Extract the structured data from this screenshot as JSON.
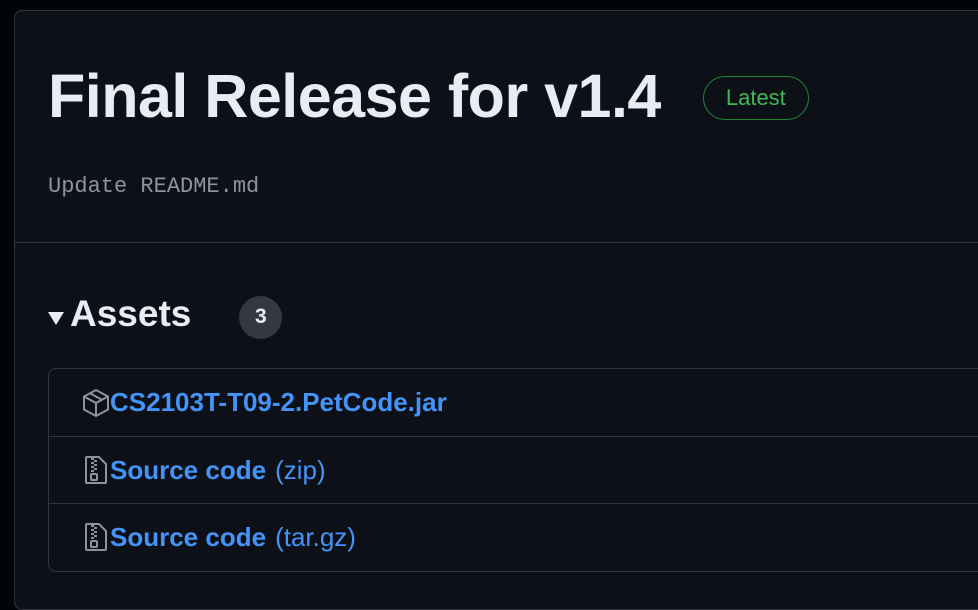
{
  "release": {
    "title": "Final Release for v1.4",
    "badge": "Latest",
    "commit_message": "Update README.md"
  },
  "assets": {
    "heading": "Assets",
    "count": "3",
    "items": [
      {
        "name": "CS2103T-T09-2.PetCode.jar",
        "suffix": "",
        "icon": "package-icon"
      },
      {
        "name": "Source code",
        "suffix": "(zip)",
        "icon": "file-zip-icon"
      },
      {
        "name": "Source code",
        "suffix": "(tar.gz)",
        "icon": "file-zip-icon"
      }
    ]
  },
  "colors": {
    "background": "#0d1117",
    "border": "#30363d",
    "title_text": "#e6edf3",
    "muted_text": "#8b949e",
    "latest_green": "#3fb950",
    "link_blue": "#4493f8"
  }
}
